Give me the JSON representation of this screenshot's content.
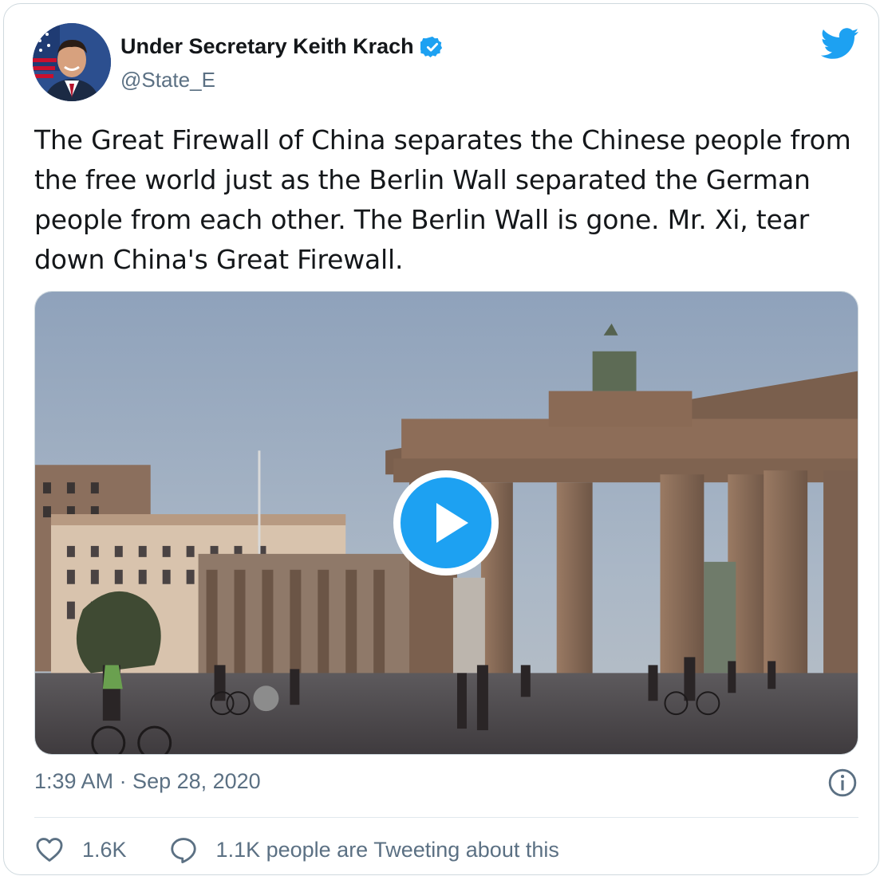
{
  "author": {
    "display_name": "Under Secretary Keith Krach",
    "handle": "@State_E",
    "verified": true
  },
  "icons": {
    "verified": "verified-badge-icon",
    "brand": "twitter-bird-icon",
    "info": "info-icon",
    "like": "heart-icon",
    "reply": "speech-bubble-icon",
    "play": "play-icon"
  },
  "colors": {
    "brand": "#1da1f2",
    "text": "#14171a",
    "secondary": "#5b7083",
    "border": "#cfd9de"
  },
  "tweet": {
    "text": "The Great Firewall of China separates the Chinese people from the free world just as the Berlin Wall separated the German people from each other. The Berlin Wall is gone. Mr. Xi, tear down China's Great Firewall.",
    "timestamp": "1:39 AM · Sep 28, 2020"
  },
  "stats": {
    "likes": "1.6K",
    "conversation": "1.1K people are Tweeting about this"
  }
}
